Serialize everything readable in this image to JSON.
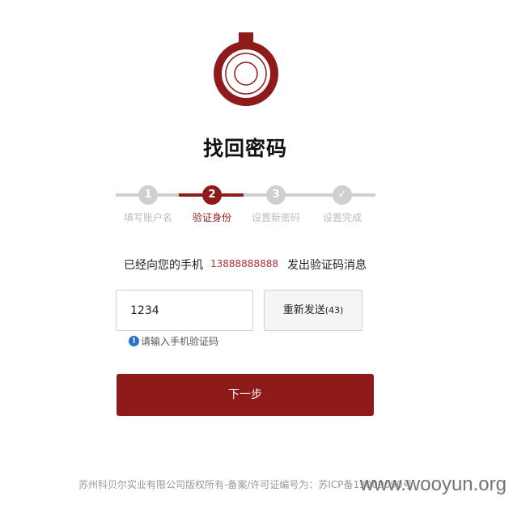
{
  "page": {
    "title": "找回密码"
  },
  "steps": [
    {
      "number": "1",
      "label": "填写账户名",
      "state": "inactive"
    },
    {
      "number": "2",
      "label": "验证身份",
      "state": "active"
    },
    {
      "number": "3",
      "label": "设置新密码",
      "state": "inactive"
    },
    {
      "number": "✓",
      "label": "设置完成",
      "state": "inactive"
    }
  ],
  "verify": {
    "prefix": "已经向您的手机",
    "phone": "13888888888",
    "suffix": "发出验证码消息",
    "code_value": "1234",
    "resend_label": "重新发送",
    "resend_countdown": "(43)",
    "hint": "请输入手机验证码",
    "hint_icon": "info-icon"
  },
  "next_button": "下一步",
  "footer": "苏州科贝尔实业有限公司版权所有-备案/许可证编号为：苏ICP备13009090号",
  "watermark": "www.wooyun.org",
  "colors": {
    "accent": "#8e1a1a",
    "inactive": "#cfcfcf",
    "link_blue": "#2a72c9"
  }
}
